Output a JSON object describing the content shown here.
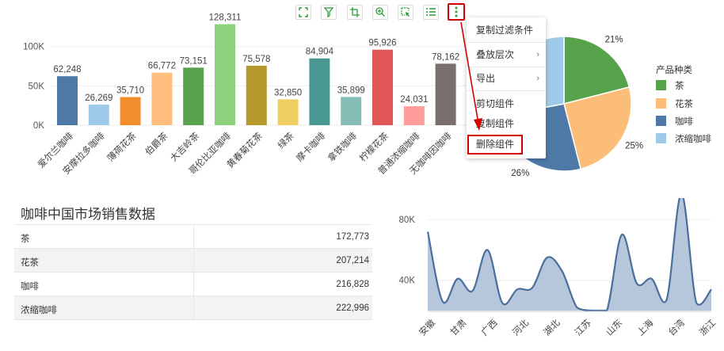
{
  "toolbar": {
    "icons": [
      "fullscreen-icon",
      "filter-icon",
      "axis-crop-icon",
      "zoom-in-icon",
      "select-icon",
      "list-icon",
      "more-vertical-icon"
    ]
  },
  "context_menu": {
    "items": [
      {
        "label": "复制过滤条件",
        "submenu": false
      },
      {
        "label": "叠放层次",
        "submenu": true
      },
      {
        "label": "导出",
        "submenu": true
      },
      {
        "label": "剪切组件",
        "submenu": false
      },
      {
        "label": "复制组件",
        "submenu": false
      },
      {
        "label": "删除组件",
        "submenu": false,
        "highlighted": true
      }
    ],
    "submenu_arrow": "›"
  },
  "colors": {
    "highlight_red": "#d40000",
    "pie": [
      "#57a34b",
      "#fbbd78",
      "#4e79a7",
      "#a0cbe8"
    ],
    "area_fill": "#a9bdd6",
    "area_line": "#4a6f9c"
  },
  "bar_chart": {
    "chart_data": {
      "type": "bar",
      "categories": [
        "爱尔兰咖啡",
        "安摩拉多咖啡",
        "薄荷花茶",
        "伯爵茶",
        "大吉岭茶",
        "哥伦比亚咖啡",
        "黄春菊花茶",
        "绿茶",
        "摩卡咖啡",
        "拿铁咖啡",
        "柠檬花茶",
        "普通浓缩咖啡",
        "无咖啡因咖啡"
      ],
      "values": [
        62248,
        26269,
        35710,
        66772,
        73151,
        128311,
        75578,
        32850,
        84904,
        35899,
        95926,
        24031,
        78162
      ],
      "data_labels": [
        "62,248",
        "26,269",
        "35,710",
        "66,772",
        "73,151",
        "128,311",
        "75,578",
        "32,850",
        "84,904",
        "35,899",
        "95,926",
        "24,031",
        "78,162"
      ],
      "colors": [
        "#4e79a7",
        "#a0cbe8",
        "#f28e2b",
        "#ffbe7d",
        "#59a14f",
        "#8cd17d",
        "#b6992d",
        "#f1ce63",
        "#499894",
        "#86bcb6",
        "#e15759",
        "#ff9d9a",
        "#79706e"
      ],
      "yticks": [
        {
          "value": 0,
          "label": "0K"
        },
        {
          "value": 50000,
          "label": "50K"
        },
        {
          "value": 100000,
          "label": "100K"
        }
      ],
      "ylim": [
        0,
        145000
      ]
    }
  },
  "pie_chart": {
    "legend_title": "产品种类",
    "chart_data": {
      "type": "pie",
      "labels": [
        "茶",
        "花茶",
        "咖啡",
        "浓缩咖啡"
      ],
      "values": [
        21,
        25,
        26,
        28
      ],
      "visible_percent_labels": [
        "21%",
        "25%",
        "26%"
      ]
    }
  },
  "table": {
    "title": "咖啡中国市场销售数据",
    "rows": [
      {
        "name": "茶",
        "value": "172,773"
      },
      {
        "name": "花茶",
        "value": "207,214"
      },
      {
        "name": "咖啡",
        "value": "216,828"
      },
      {
        "name": "浓缩咖啡",
        "value": "222,996"
      }
    ]
  },
  "area_chart": {
    "chart_data": {
      "type": "area",
      "x_labels": [
        "安徽",
        "甘肃",
        "广西",
        "河北",
        "湖北",
        "江苏",
        "山东",
        "上海",
        "台湾",
        "浙江"
      ],
      "yticks": [
        {
          "value": 40000,
          "label": "40K"
        },
        {
          "value": 80000,
          "label": "80K"
        }
      ],
      "ylim": [
        20000,
        90000
      ],
      "values": [
        72000,
        26000,
        41000,
        33000,
        60000,
        25000,
        34000,
        35000,
        55000,
        46000,
        22000,
        15000,
        10000,
        70000,
        38000,
        41000,
        27000,
        97000,
        25000,
        34000
      ]
    }
  }
}
